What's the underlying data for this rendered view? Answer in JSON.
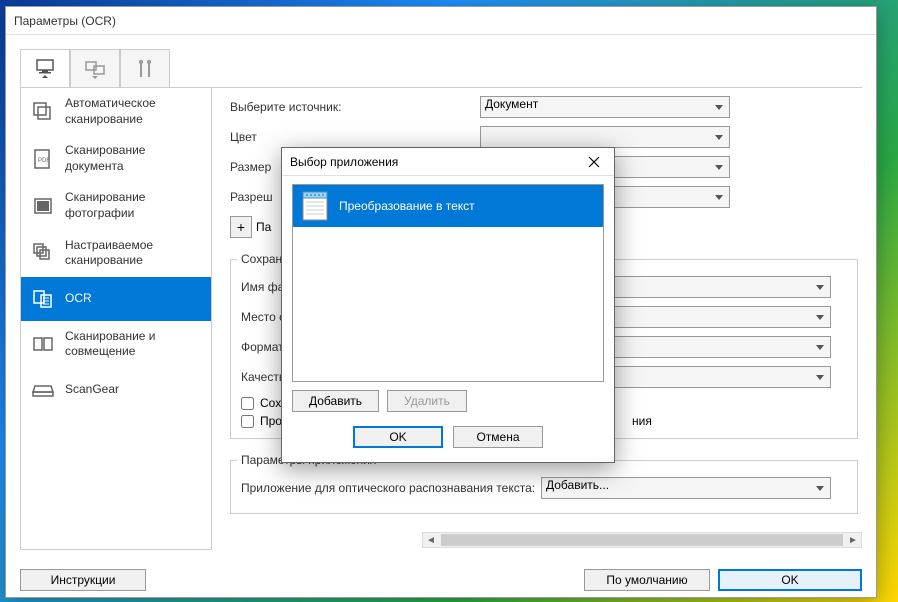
{
  "window": {
    "title": "Параметры (OCR)"
  },
  "sidebar": {
    "items": [
      {
        "label": "Автоматическое сканирование"
      },
      {
        "label": "Сканирование документа"
      },
      {
        "label": "Сканирование фотографии"
      },
      {
        "label": "Настраиваемое сканирование"
      },
      {
        "label": "OCR"
      },
      {
        "label": "Сканирование и совмещение"
      },
      {
        "label": "ScanGear"
      }
    ]
  },
  "form": {
    "source_label": "Выберите источник:",
    "source_value": "Документ",
    "color_label": "Цвет",
    "size_label": "Размер",
    "resolution_label": "Разреш",
    "params_label": "Па",
    "save_section": "Сохранит",
    "filename_label": "Имя фа",
    "location_label": "Место с",
    "format_label": "Формат",
    "quality_label": "Качеств",
    "cb_save": "Сох",
    "cb_check": "Про",
    "cb_check_suffix": "ния",
    "app_section": "Параметры приложения",
    "app_label": "Приложение для оптического распознавания текста:",
    "app_value": "Добавить..."
  },
  "footer": {
    "instructions": "Инструкции",
    "defaults": "По умолчанию",
    "ok": "OK"
  },
  "dialog": {
    "title": "Выбор приложения",
    "item": "Преобразование в текст",
    "add": "Добавить",
    "delete": "Удалить",
    "ok": "OK",
    "cancel": "Отмена"
  }
}
